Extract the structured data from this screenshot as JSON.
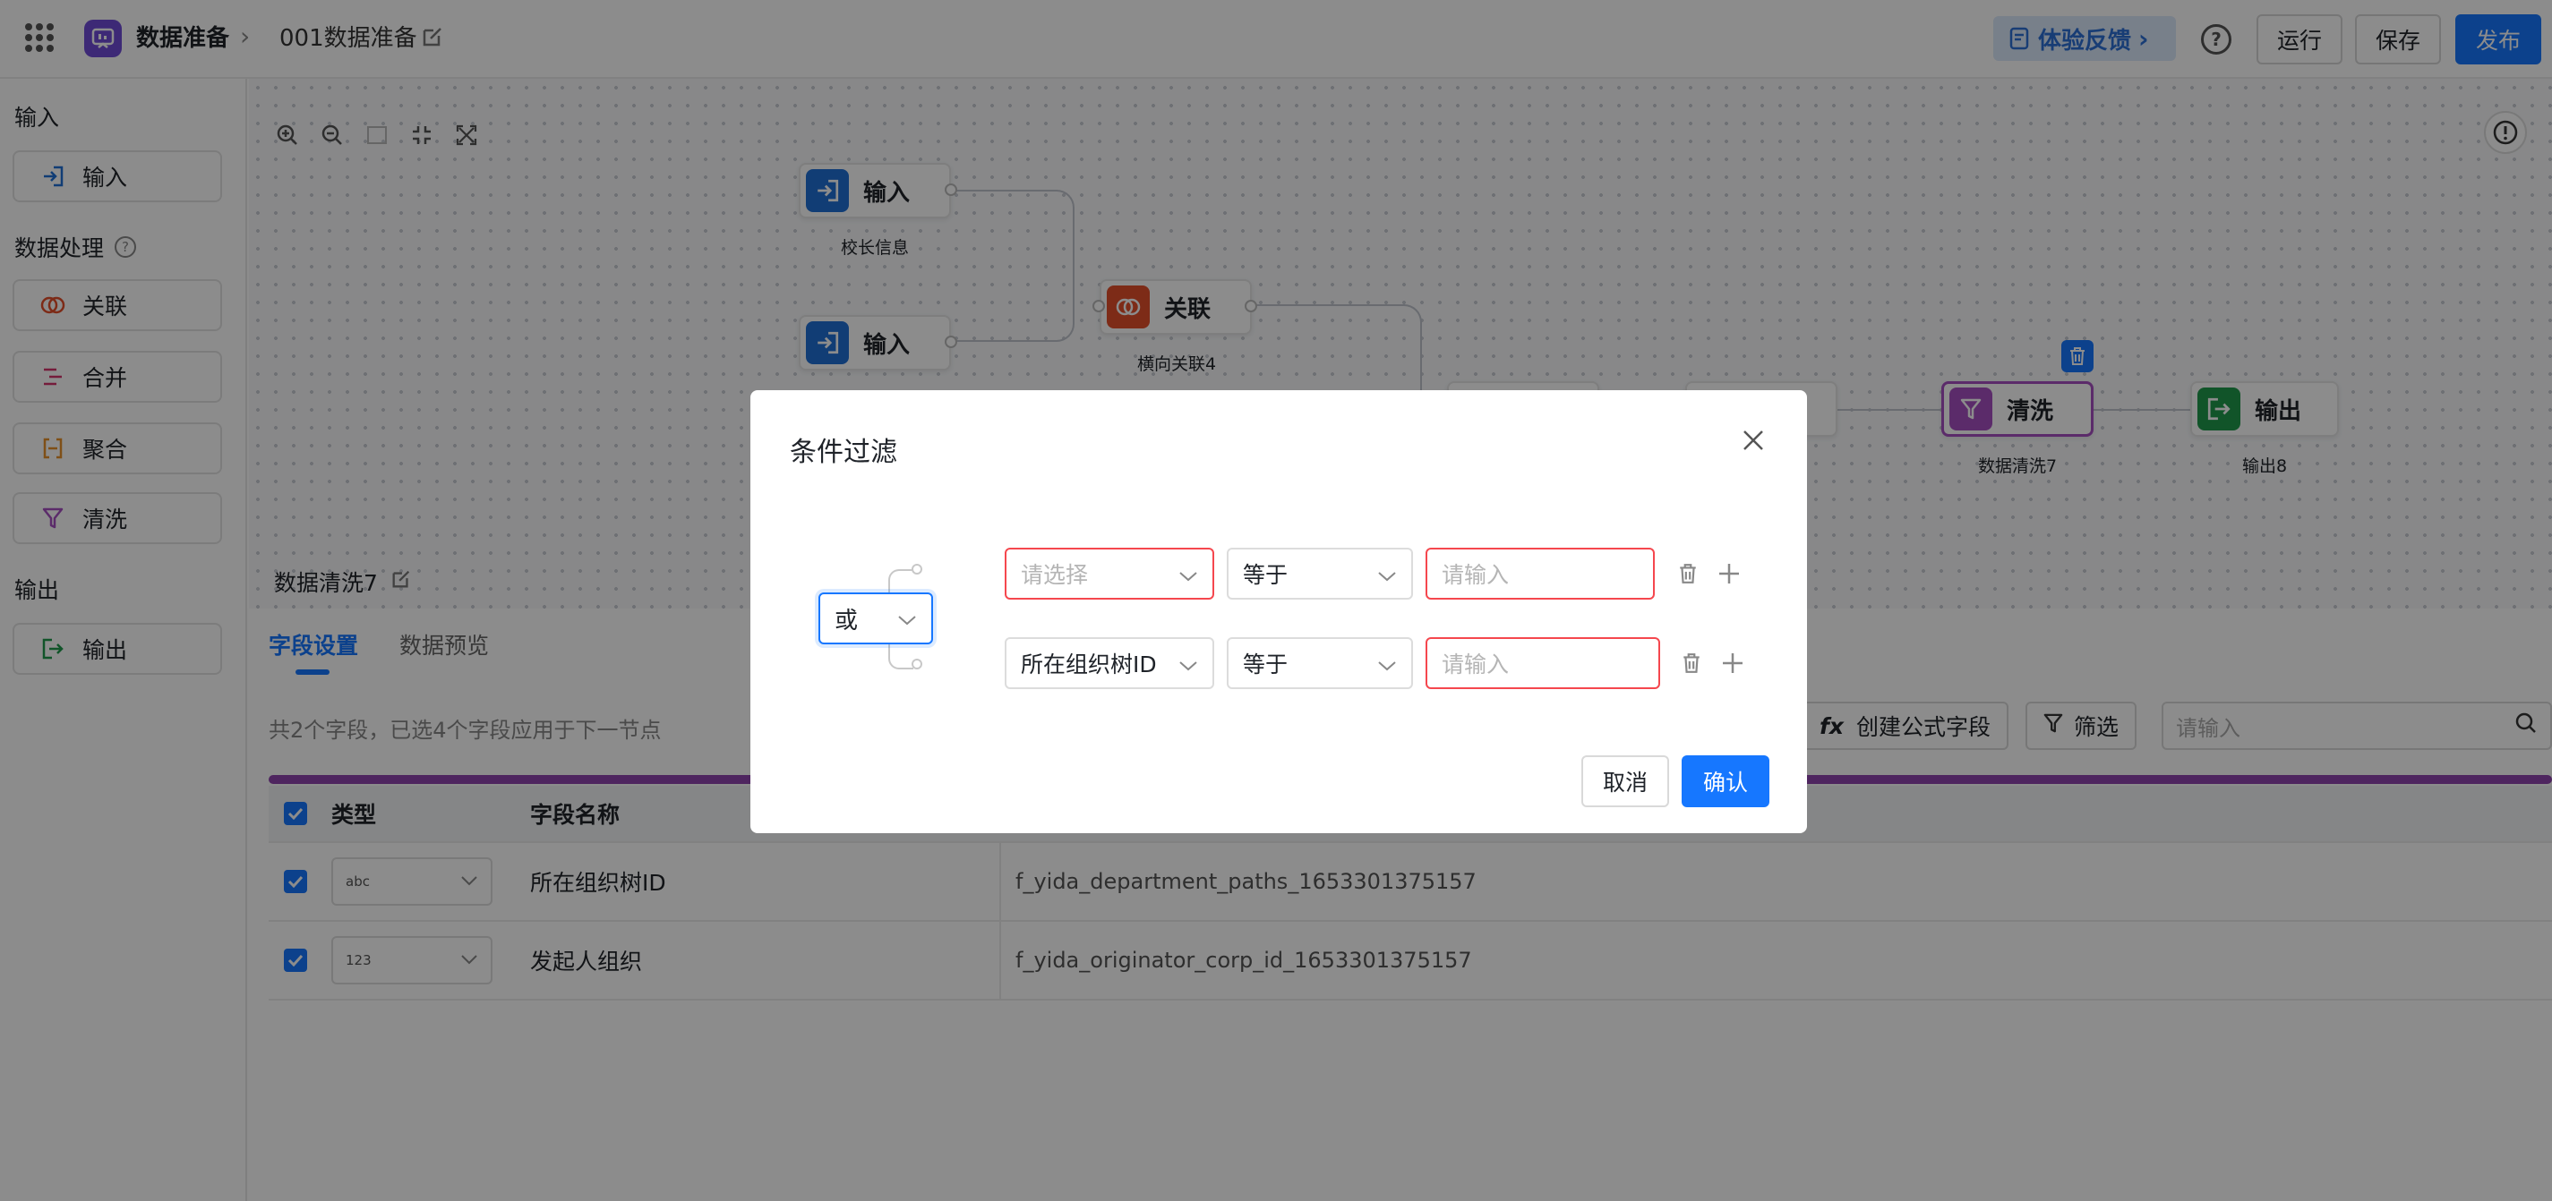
{
  "header": {
    "app_title": "数据准备",
    "breadcrumb": "001数据准备",
    "feedback_label": "体验反馈",
    "help_label": "?",
    "run_label": "运行",
    "save_label": "保存",
    "publish_label": "发布"
  },
  "sidebar": {
    "input_section": "输入",
    "processing_section": "数据处理",
    "output_section": "输出",
    "items": [
      {
        "label": "输入",
        "icon": "input-arrow-icon"
      },
      {
        "label": "关联",
        "icon": "join-rings-icon"
      },
      {
        "label": "合并",
        "icon": "merge-lines-icon"
      },
      {
        "label": "聚合",
        "icon": "aggregate-icon"
      },
      {
        "label": "清洗",
        "icon": "funnel-icon"
      },
      {
        "label": "输出",
        "icon": "output-arrow-icon"
      }
    ]
  },
  "canvas": {
    "nodes": [
      {
        "label": "输入",
        "caption": "校长信息",
        "color": "#1f6fd6"
      },
      {
        "label": "输入",
        "caption": "",
        "color": "#1f6fd6"
      },
      {
        "label": "关联",
        "caption": "横向关联4",
        "color": "#e34f2b"
      },
      {
        "label": "清洗",
        "caption": "数据清洗7",
        "color": "#a64fc1"
      },
      {
        "label": "输出",
        "caption": "输出8",
        "color": "#1f9a4b"
      }
    ]
  },
  "bottom_panel": {
    "title": "数据清洗7",
    "tabs": [
      "字段设置",
      "数据预览"
    ],
    "summary": "共2个字段，已选4个字段应用于下一节点",
    "formula_label": "创建公式字段",
    "filter_label": "筛选",
    "search_placeholder": "请输入",
    "columns": {
      "type": "类型",
      "name": "字段名称"
    },
    "rows": [
      {
        "type": "abc",
        "name": "所在组织树ID",
        "field": "f_yida_department_paths_1653301375157"
      },
      {
        "type": "123",
        "name": "发起人组织",
        "field": "f_yida_originator_corp_id_1653301375157"
      }
    ]
  },
  "modal": {
    "title": "条件过滤",
    "logic_value": "或",
    "conditions": [
      {
        "field": "",
        "field_placeholder": "请选择",
        "operator": "等于",
        "value_placeholder": "请输入"
      },
      {
        "field": "所在组织树ID",
        "field_placeholder": "",
        "operator": "等于",
        "value_placeholder": "请输入"
      }
    ],
    "cancel_label": "取消",
    "confirm_label": "确认"
  },
  "colors": {
    "primary": "#1677ff",
    "error": "#f5474e",
    "clean_bar": "#8e44ad",
    "brand": "#6f4bd8"
  }
}
